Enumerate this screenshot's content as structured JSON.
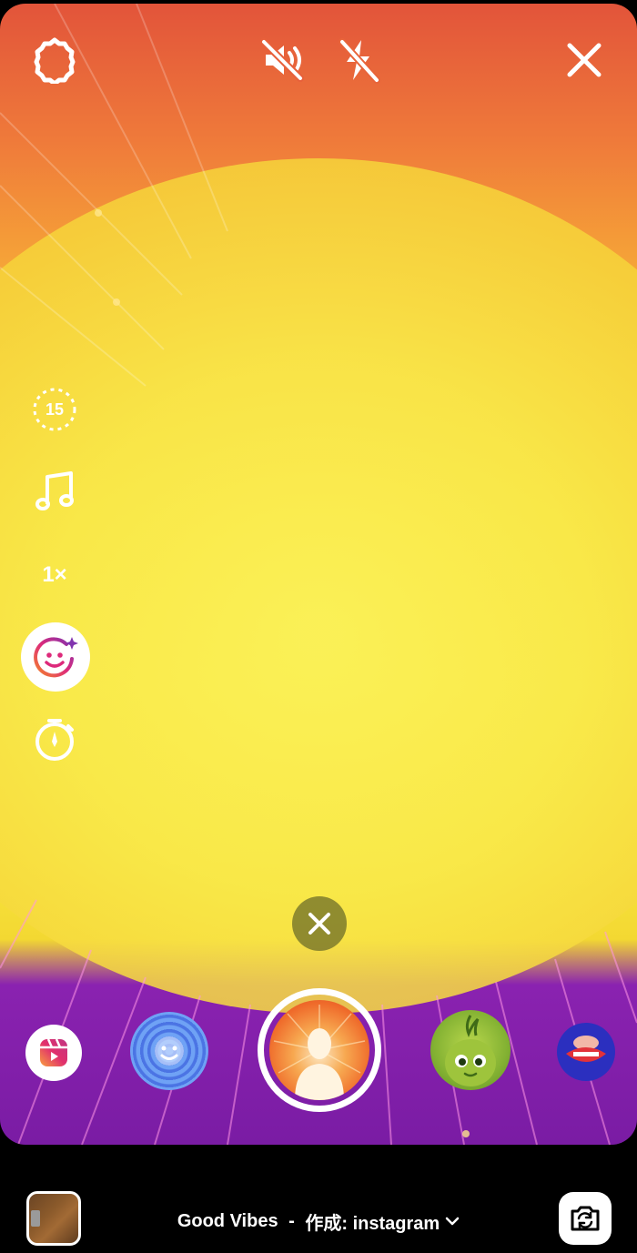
{
  "top_bar": {
    "settings_icon": "gear-icon",
    "sound_icon": "speaker-muted-icon",
    "flash_icon": "flash-off-icon",
    "close_icon": "close-icon"
  },
  "side_tools": {
    "duration_label": "15",
    "music_icon": "music-note-icon",
    "zoom_label": "1×",
    "effects_icon": "face-sparkle-icon",
    "timer_icon": "timer-icon"
  },
  "effect_tray": {
    "reels_icon": "reels-icon",
    "thumbs": [
      "face-effect",
      "good-vibes-effect",
      "green-character-effect",
      "lips-effect"
    ]
  },
  "bottom_bar": {
    "effect_title": "Good Vibes",
    "effect_separator": " - ",
    "effect_creator": "作成: instagram",
    "chevron_icon": "chevron-down-icon",
    "flip_icon": "camera-flip-icon"
  },
  "colors": {
    "sun_yellow": "#f9ec48",
    "top_orange": "#e2543a",
    "ground_purple": "#8a22b0",
    "reels_pink": "#e1306c"
  }
}
